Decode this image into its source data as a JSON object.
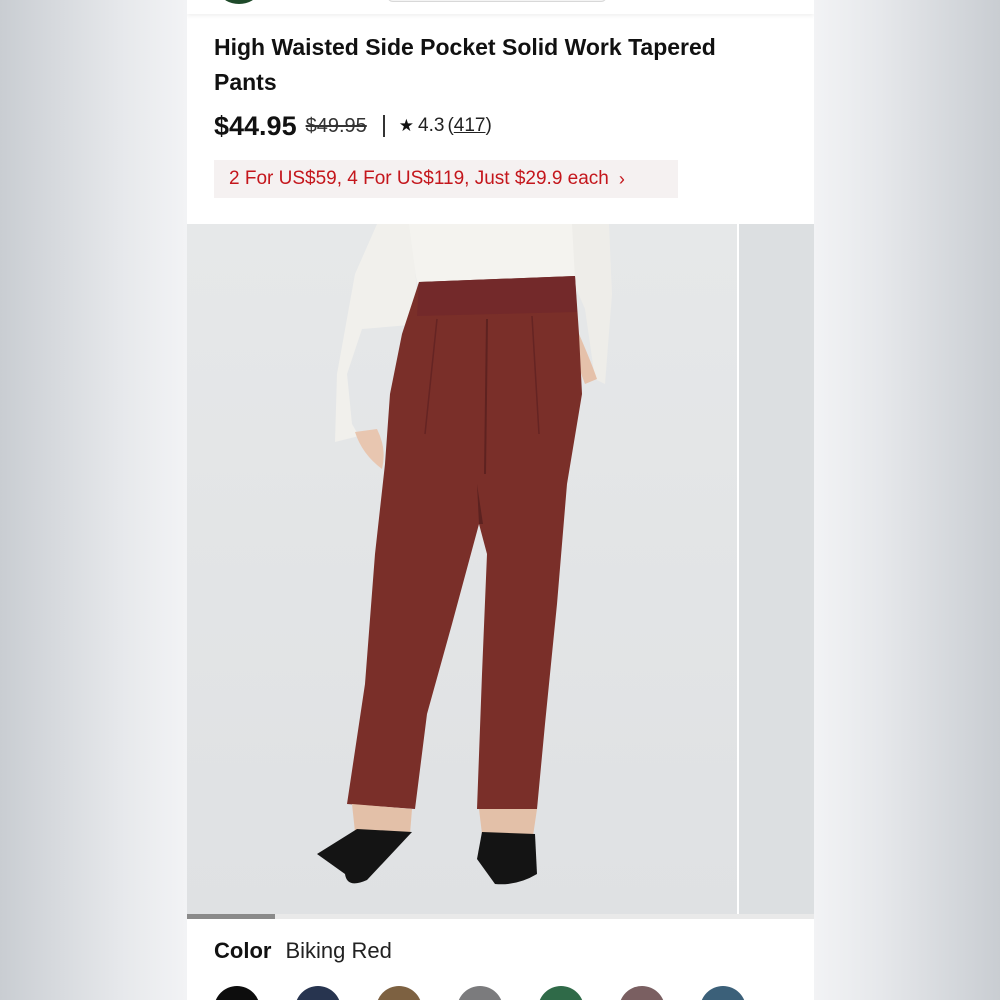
{
  "product": {
    "title": "High Waisted Side Pocket Solid Work Tapered Pants",
    "price_current": "$44.95",
    "price_original": "$49.95",
    "rating": "4.3",
    "reviews_count": "417",
    "promo_text": "2 For US$59, 4 For US$119, Just $29.9 each"
  },
  "gallery": {
    "image_index_fraction": 0.14
  },
  "color": {
    "label": "Color",
    "selected": "Biking Red",
    "swatches": [
      "#0d0d0d",
      "#27344f",
      "#7d6141",
      "#7b7b7d",
      "#2f6a48",
      "#7a5f61",
      "#3b6079"
    ]
  },
  "colors": {
    "promo_text": "#c4161c",
    "product_pant": "#7a2f29"
  },
  "icons": {
    "star": "star-icon",
    "promo_chevron": "chevron-right-icon"
  }
}
